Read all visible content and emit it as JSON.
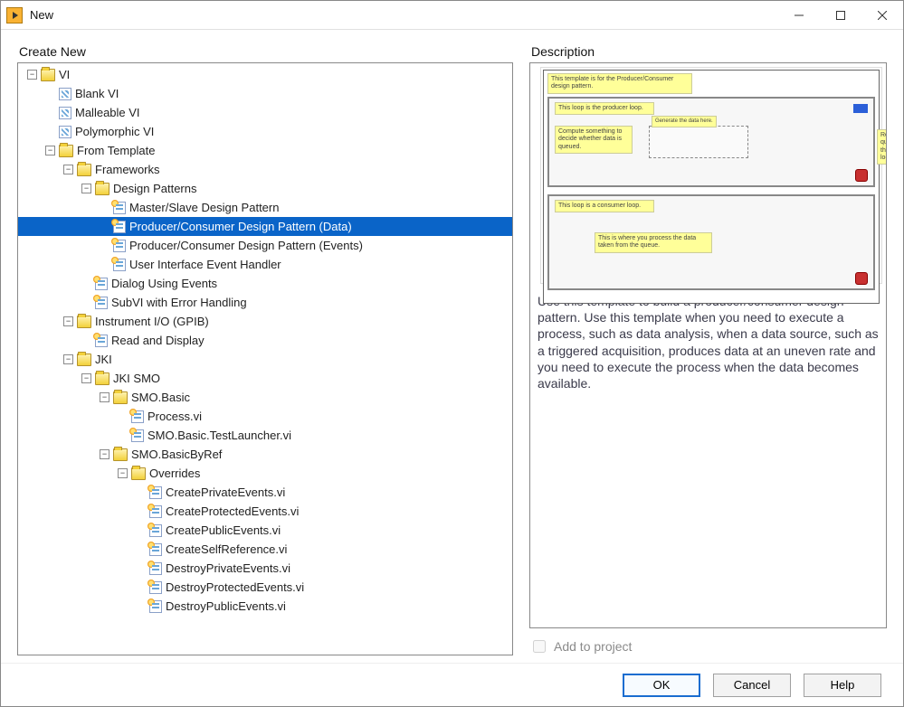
{
  "window": {
    "title": "New"
  },
  "panes": {
    "create_new_label": "Create New",
    "description_label": "Description"
  },
  "tree": [
    {
      "d": 0,
      "ic": "folder-open",
      "t": "minus",
      "label": "VI"
    },
    {
      "d": 1,
      "ic": "vi",
      "t": "none",
      "label": "Blank VI"
    },
    {
      "d": 1,
      "ic": "vi",
      "t": "none",
      "label": "Malleable VI"
    },
    {
      "d": 1,
      "ic": "vi",
      "t": "none",
      "label": "Polymorphic VI"
    },
    {
      "d": 1,
      "ic": "folder-open",
      "t": "minus",
      "label": "From Template"
    },
    {
      "d": 2,
      "ic": "folder-open",
      "t": "minus",
      "label": "Frameworks"
    },
    {
      "d": 3,
      "ic": "folder-open",
      "t": "minus",
      "label": "Design Patterns"
    },
    {
      "d": 4,
      "ic": "vi-tpl",
      "t": "none",
      "label": "Master/Slave Design Pattern"
    },
    {
      "d": 4,
      "ic": "vi-tpl",
      "t": "none",
      "label": "Producer/Consumer Design Pattern (Data)",
      "selected": true
    },
    {
      "d": 4,
      "ic": "vi-tpl",
      "t": "none",
      "label": "Producer/Consumer Design Pattern (Events)"
    },
    {
      "d": 4,
      "ic": "vi-tpl",
      "t": "none",
      "label": "User Interface Event Handler"
    },
    {
      "d": 3,
      "ic": "vi-tpl",
      "t": "none",
      "label": "Dialog Using Events"
    },
    {
      "d": 3,
      "ic": "vi-tpl",
      "t": "none",
      "label": "SubVI with Error Handling"
    },
    {
      "d": 2,
      "ic": "folder-open",
      "t": "minus",
      "label": "Instrument I/O (GPIB)"
    },
    {
      "d": 3,
      "ic": "vi-tpl",
      "t": "none",
      "label": "Read and Display"
    },
    {
      "d": 2,
      "ic": "folder-open",
      "t": "minus",
      "label": "JKI"
    },
    {
      "d": 3,
      "ic": "folder-open",
      "t": "minus",
      "label": "JKI SMO"
    },
    {
      "d": 4,
      "ic": "folder-open",
      "t": "minus",
      "label": "SMO.Basic"
    },
    {
      "d": 5,
      "ic": "vi-tpl",
      "t": "none",
      "label": "Process.vi"
    },
    {
      "d": 5,
      "ic": "vi-tpl",
      "t": "none",
      "label": "SMO.Basic.TestLauncher.vi"
    },
    {
      "d": 4,
      "ic": "folder-open",
      "t": "minus",
      "label": "SMO.BasicByRef"
    },
    {
      "d": 5,
      "ic": "folder-open",
      "t": "minus",
      "label": "Overrides"
    },
    {
      "d": 6,
      "ic": "vi-tpl",
      "t": "none",
      "label": "CreatePrivateEvents.vi"
    },
    {
      "d": 6,
      "ic": "vi-tpl",
      "t": "none",
      "label": "CreateProtectedEvents.vi"
    },
    {
      "d": 6,
      "ic": "vi-tpl",
      "t": "none",
      "label": "CreatePublicEvents.vi"
    },
    {
      "d": 6,
      "ic": "vi-tpl",
      "t": "none",
      "label": "CreateSelfReference.vi"
    },
    {
      "d": 6,
      "ic": "vi-tpl",
      "t": "none",
      "label": "DestroyPrivateEvents.vi"
    },
    {
      "d": 6,
      "ic": "vi-tpl",
      "t": "none",
      "label": "DestroyProtectedEvents.vi"
    },
    {
      "d": 6,
      "ic": "vi-tpl",
      "t": "none",
      "label": "DestroyPublicEvents.vi"
    }
  ],
  "description": {
    "text": "Use this template to build a producer/consumer design pattern. Use this template when you need to execute a process, such as data analysis, when a data source, such as a triggered acquisition, produces data at an uneven rate and you need to execute the process when the data becomes available."
  },
  "add_to_project": {
    "label": "Add to project",
    "enabled": false,
    "checked": false
  },
  "buttons": {
    "ok": "OK",
    "cancel": "Cancel",
    "help": "Help"
  }
}
